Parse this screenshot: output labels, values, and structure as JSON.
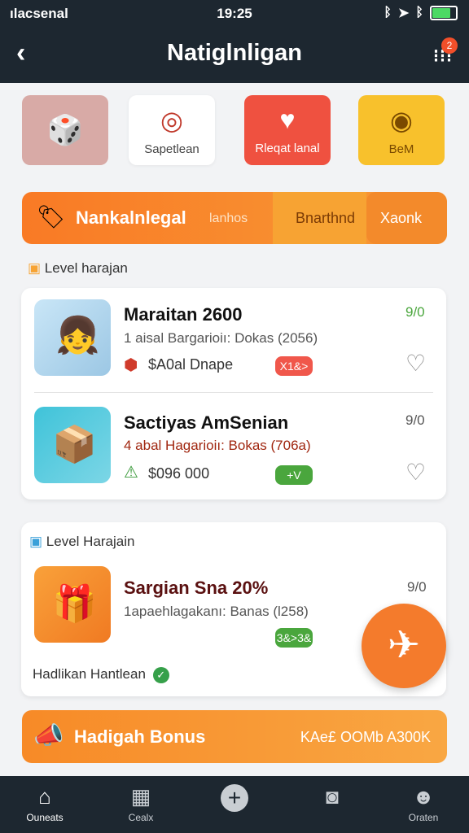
{
  "status": {
    "carrier": "ılacsenal",
    "time": "19:25"
  },
  "header": {
    "title": "Natiglnligan",
    "back_icon": "chevron-left-icon",
    "menu_icon": "more-icon",
    "badge": "2"
  },
  "tiles": [
    {
      "label": "",
      "color": "#d7a9a5",
      "icon": "game-icon"
    },
    {
      "label": "Sapetlean",
      "color": "#ffffff",
      "icon": "target-icon"
    },
    {
      "label": "Rleqat lanal",
      "color": "#ef5140",
      "icon": "gift-icon"
    },
    {
      "label": "BeM",
      "color": "#f8c12c",
      "icon": "chat-icon"
    }
  ],
  "promo": {
    "title": "Nankalnlegal",
    "subtitle": "lanhos",
    "mid": "Bnarthnd",
    "end": "Xaonk"
  },
  "section1": {
    "heading": "Level harajan"
  },
  "items": [
    {
      "title": "Maraitan 2600",
      "subtitle": "1 aisal Bargarioiı: Dokas (2056)",
      "price": "$A0al Dnape",
      "pill": "X1&>",
      "pill_color": "#f0574b",
      "count": "9/0"
    },
    {
      "title": "Sactiyas AmSenian",
      "subtitle": "4 abal Hagarioiı: Bokas (706a)",
      "price": "$096 000",
      "pill": "+V",
      "pill_color": "#4aa63d",
      "count": "9/0"
    }
  ],
  "section2": {
    "heading": "Level Harajain",
    "item": {
      "title": "Sargian Sna 20%",
      "subtitle": "1apaehlagakanı: Banas (l258)",
      "pill": "3&>3&",
      "pill_color": "#4aa63d",
      "count": "9/0"
    },
    "footer": "Hadlikan Hantlean"
  },
  "bonus": {
    "title": "Hadigah Bonus",
    "right": "KAe£ OOMb  A300K"
  },
  "tabs": [
    {
      "label": "Ouneats",
      "icon": "home-icon"
    },
    {
      "label": "Cealx",
      "icon": "calendar-icon"
    },
    {
      "label": "",
      "icon": "plus-icon"
    },
    {
      "label": "",
      "icon": "camera-icon"
    },
    {
      "label": "Oraten",
      "icon": "profile-icon"
    }
  ],
  "colors": {
    "accent": "#f47b2c",
    "navbar": "#1d2730",
    "green": "#4aa63d"
  }
}
